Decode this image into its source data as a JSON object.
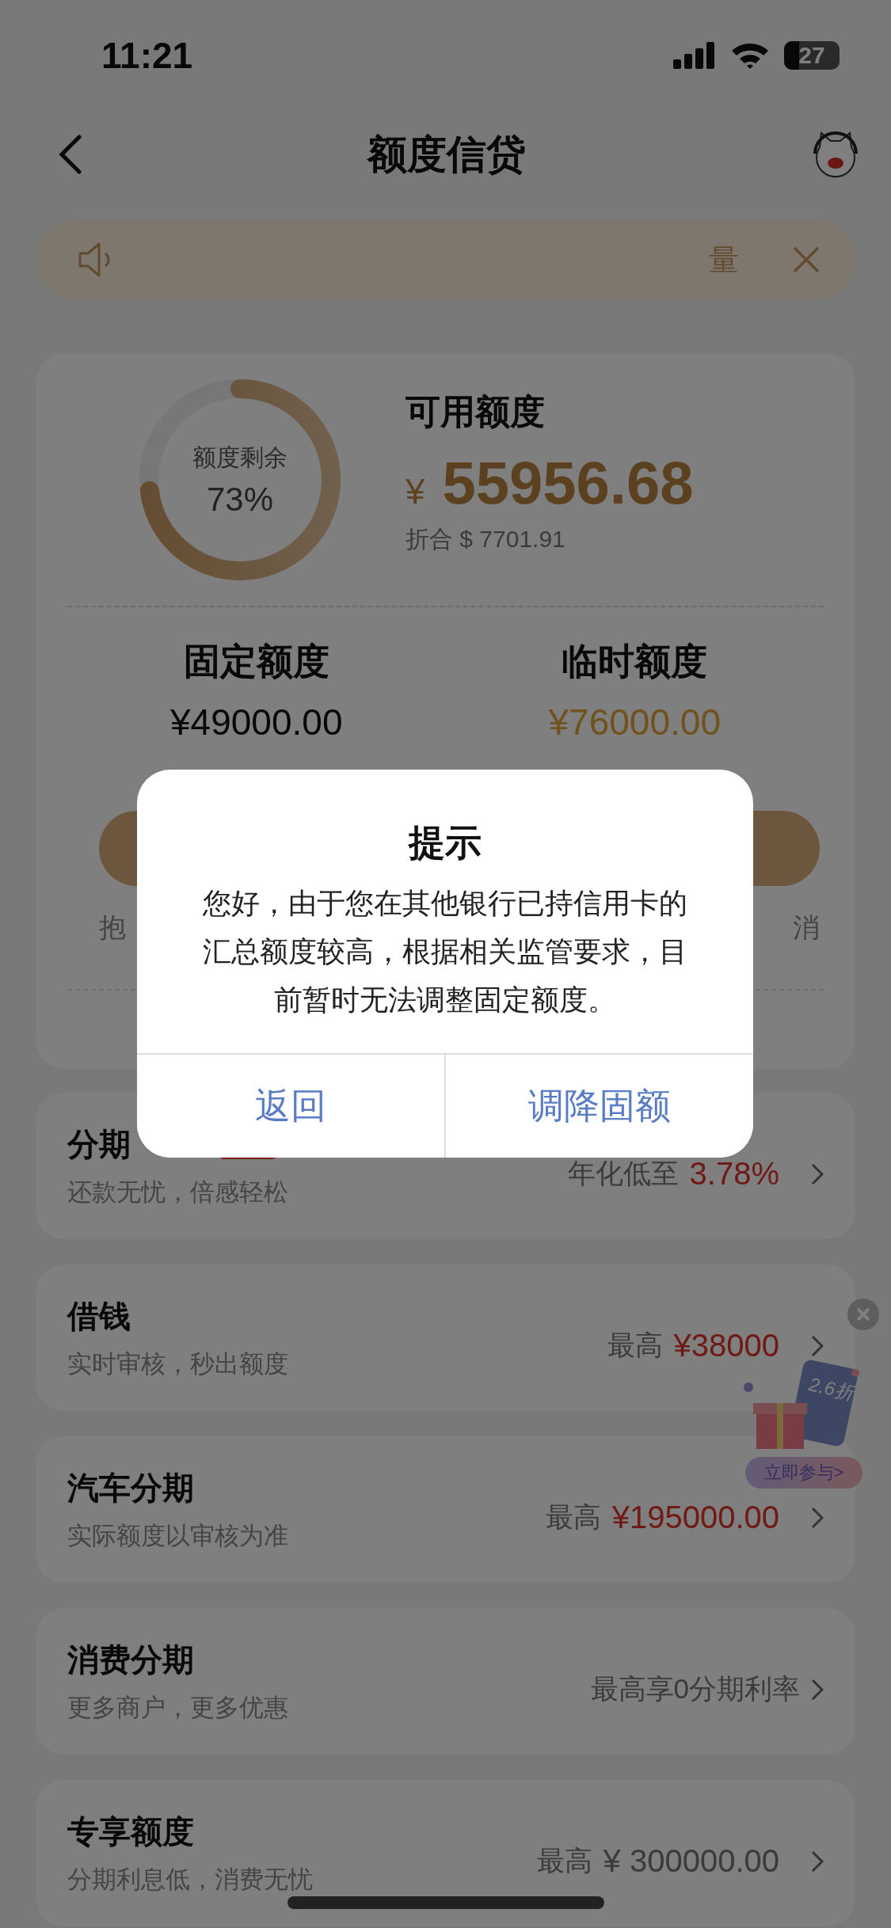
{
  "status_bar": {
    "time": "11:21",
    "battery": "27"
  },
  "nav": {
    "title": "额度信贷"
  },
  "notice": {
    "text": "量"
  },
  "credit": {
    "ring_label": "额度剩余",
    "ring_value": "73%",
    "level": 0.73,
    "title": "可用额度",
    "currency": "¥",
    "amount": "55956.68",
    "converted": "折合 $ 7701.91"
  },
  "quotas": [
    {
      "title": "固定额度",
      "amount": "¥49000.00",
      "kind": "fixed"
    },
    {
      "title": "临时额度",
      "amount": "¥76000.00",
      "kind": "temporary"
    }
  ],
  "actions": [
    {
      "label": "抱"
    },
    {
      "label": "消"
    }
  ],
  "products": [
    {
      "title": "分期",
      "subtitle": "还款无忧，倍感轻松",
      "prefix": "年化低至",
      "value": "3.78%",
      "highlight": true,
      "badge": true
    },
    {
      "title": "借钱",
      "subtitle": "实时审核，秒出额度",
      "prefix": "最高",
      "value": "¥38000",
      "highlight": true,
      "badge": false
    },
    {
      "title": "汽车分期",
      "subtitle": "实际额度以审核为准",
      "prefix": "最高",
      "value": "¥195000.00",
      "highlight": true,
      "badge": false
    },
    {
      "title": "消费分期",
      "subtitle": "更多商户，更多优惠",
      "prefix": "最高享0分期利率",
      "badge": false
    },
    {
      "title": "专享额度",
      "subtitle": "分期利息低，消费无忧",
      "prefix": "最高",
      "value": "¥ 300000.00",
      "highlight": false,
      "badge": false
    }
  ],
  "promo": {
    "discount": "2.6折",
    "button": "立即参与>"
  },
  "dialog": {
    "title": "提示",
    "message": "您好，由于您在其他银行已持信用卡的汇总额度较高，根据相关监管要求，目前暂时无法调整固定额度。",
    "buttons": [
      "返回",
      "调降固额"
    ]
  }
}
